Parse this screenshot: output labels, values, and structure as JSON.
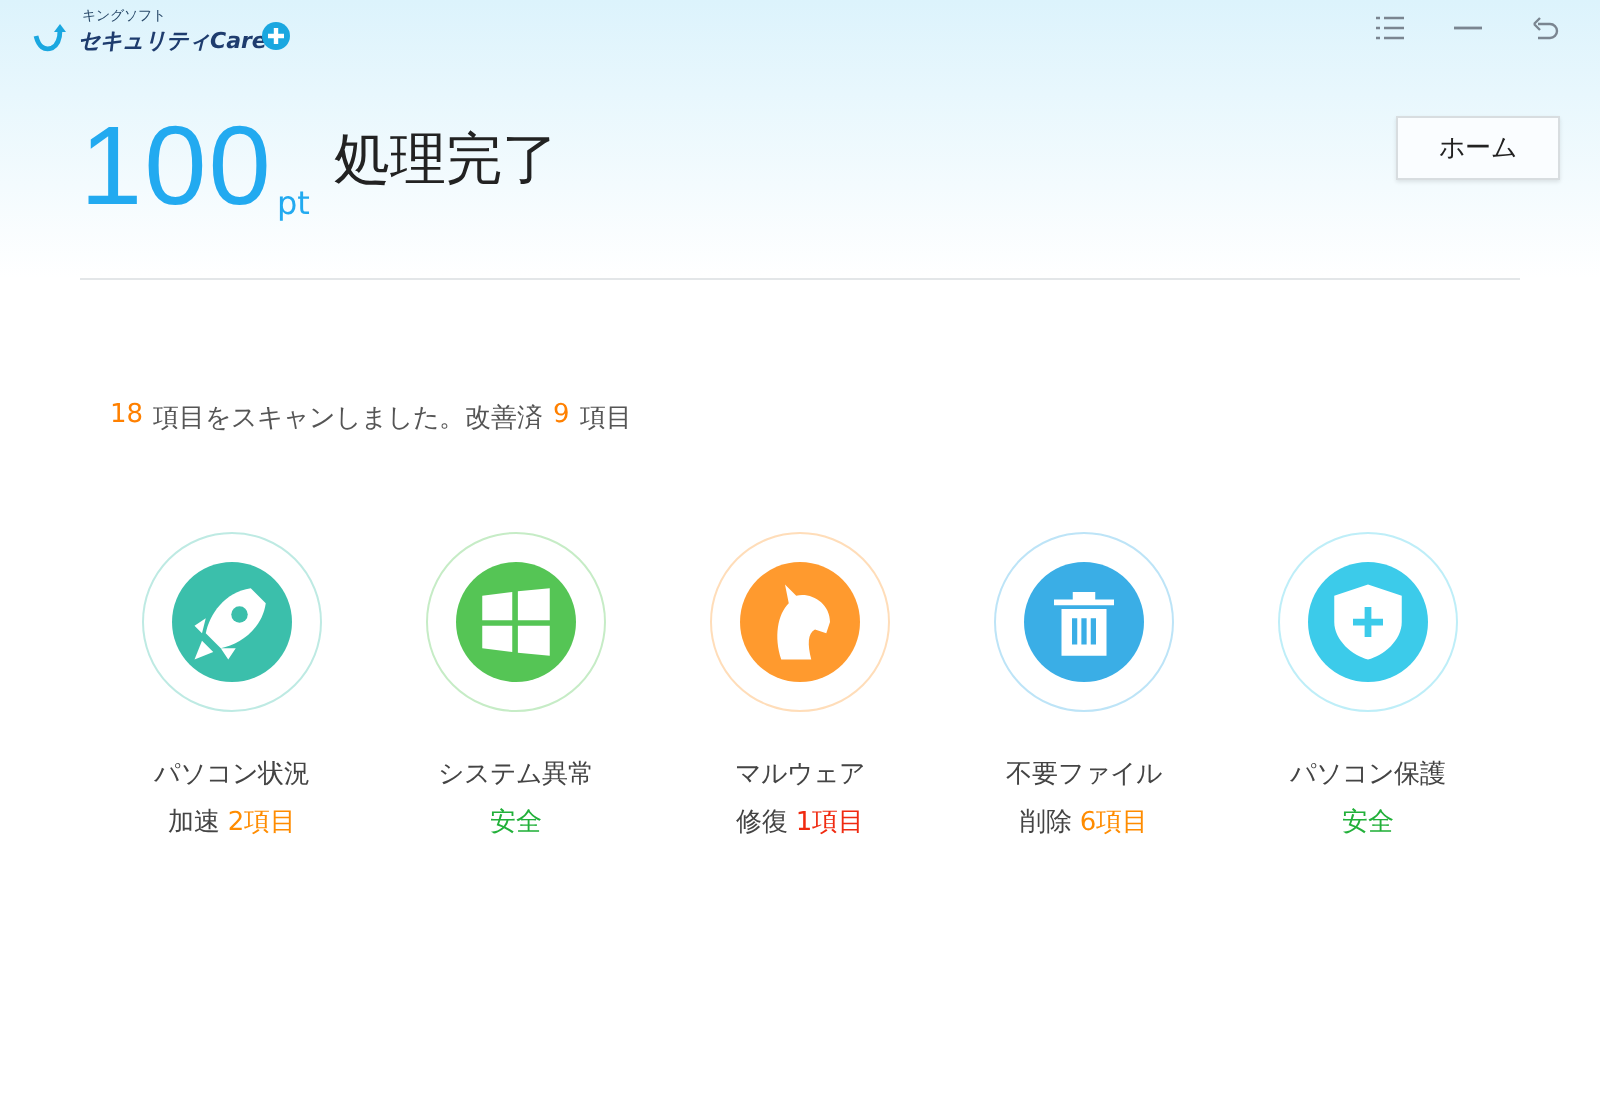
{
  "app": {
    "brand_small": "キングソフト",
    "brand_name": "セキュリティCare"
  },
  "header": {
    "score": "100",
    "unit": "pt",
    "title": "処理完了",
    "home_button": "ホーム"
  },
  "summary": [
    {
      "kind": "count",
      "text": "18"
    },
    {
      "kind": "text",
      "text": "項目をスキャンしました。改善済"
    },
    {
      "kind": "count",
      "text": "9"
    },
    {
      "kind": "text",
      "text": "項目"
    }
  ],
  "items": [
    {
      "kind": "rocket",
      "color": "#3bbfab",
      "title": "パソコン状況",
      "action": "加速",
      "result": {
        "text": "2項目",
        "color": "#ff8c00"
      }
    },
    {
      "kind": "windows",
      "color": "#55c555",
      "title": "システム異常",
      "result": {
        "text": "安全",
        "color": "#22b03a"
      }
    },
    {
      "kind": "horse",
      "color": "#ff9a2e",
      "title": "マルウェア",
      "action": "修復",
      "result": {
        "text": "1項目",
        "color": "#f02a10"
      }
    },
    {
      "kind": "trash",
      "color": "#3aaee6",
      "title": "不要ファイル",
      "action": "削除",
      "result": {
        "text": "6項目",
        "color": "#ff8c00"
      }
    },
    {
      "kind": "shield",
      "color": "#3ccbea",
      "title": "パソコン保護",
      "result": {
        "text": "安全",
        "color": "#22b03a"
      }
    }
  ]
}
